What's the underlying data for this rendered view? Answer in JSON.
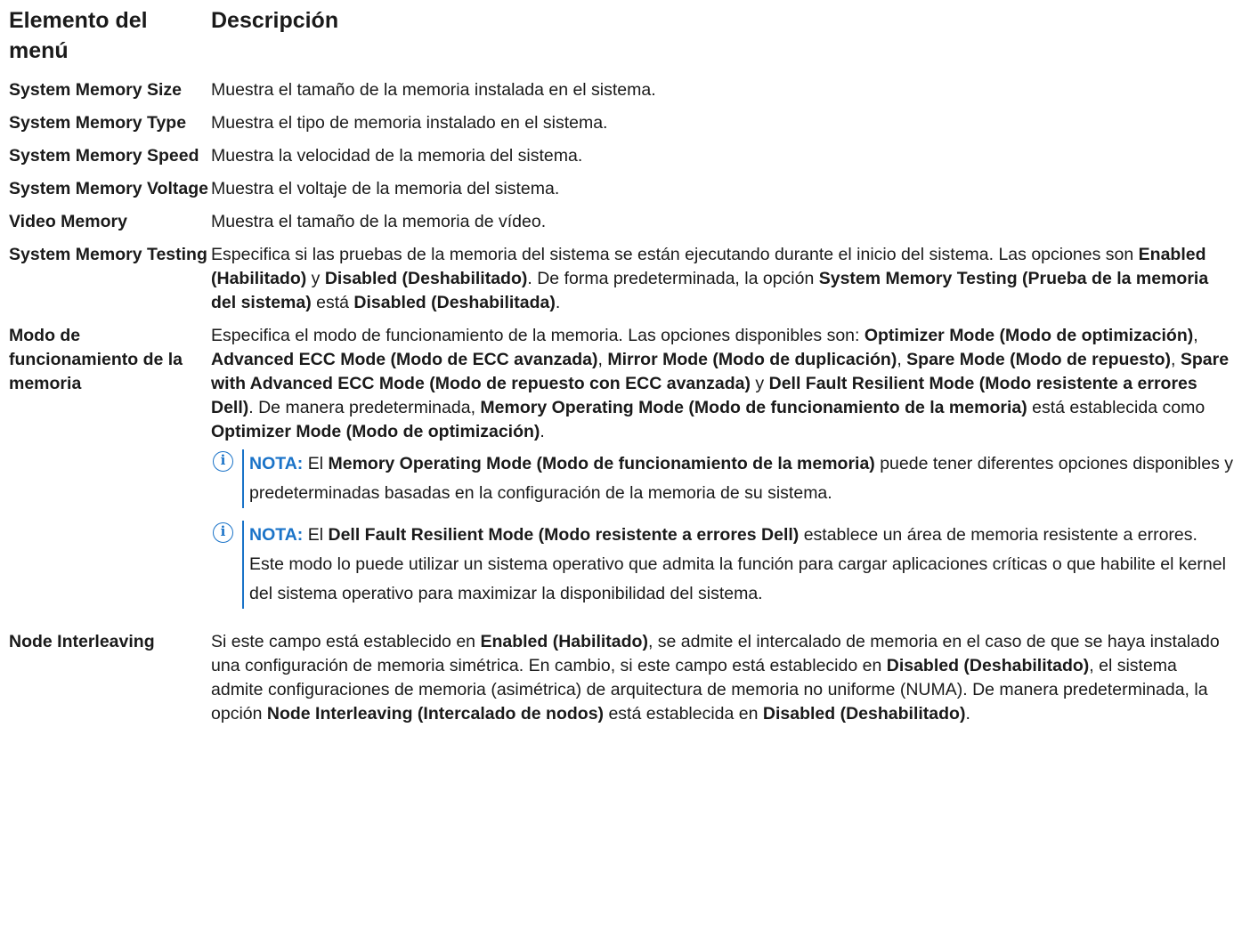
{
  "header": {
    "col1": "Elemento del menú",
    "col2": "Descripción"
  },
  "rows": [
    {
      "name": "System Memory Size",
      "desc": "Muestra el tamaño de la memoria instalada en el sistema."
    },
    {
      "name": "System Memory Type",
      "desc": "Muestra el tipo de memoria instalado en el sistema."
    },
    {
      "name": "System Memory Speed",
      "desc": "Muestra la velocidad de la memoria del sistema."
    },
    {
      "name": "System Memory Voltage",
      "desc": "Muestra el voltaje de la memoria del sistema."
    },
    {
      "name": "Video Memory",
      "desc": "Muestra el tamaño de la memoria de vídeo."
    }
  ],
  "testing": {
    "name": "System Memory Testing",
    "t1": "Especifica si las pruebas de la memoria del sistema se están ejecutando durante el inicio del sistema. Las opciones son ",
    "b1": "Enabled (Habilitado)",
    "t2": " y ",
    "b2": "Disabled (Deshabilitado)",
    "t3": ". De forma predeterminada, la opción ",
    "b3": "System Memory Testing (Prueba de la memoria del sistema)",
    "t4": " está ",
    "b4": "Disabled (Deshabilitada)",
    "t5": "."
  },
  "opmode": {
    "name": "Modo de funcionamiento de la memoria",
    "t1": "Especifica el modo de funcionamiento de la memoria. Las opciones disponibles son: ",
    "b1": "Optimizer Mode (Modo de optimización)",
    "t2": ", ",
    "b2": "Advanced ECC Mode (Modo de ECC avanzada)",
    "t3": ", ",
    "b3": "Mirror Mode (Modo de duplicación)",
    "t4": ", ",
    "b4": "Spare Mode (Modo de repuesto)",
    "t5": ", ",
    "b5": "Spare with Advanced ECC Mode (Modo de repuesto con ECC avanzada)",
    "t6": " y ",
    "b6": "Dell Fault Resilient Mode (Modo resistente a errores Dell)",
    "t7": ". De manera predeterminada, ",
    "b7": "Memory Operating Mode (Modo de funcionamiento de la memoria)",
    "t8": " está establecida como ",
    "b8": "Optimizer Mode (Modo de optimización)",
    "t9": ".",
    "note1": {
      "label": "NOTA:",
      "t1": " El ",
      "b1": "Memory Operating Mode (Modo de funcionamiento de la memoria)",
      "t2": " puede tener diferentes opciones disponibles y predeterminadas basadas en la configuración de la memoria de su sistema."
    },
    "note2": {
      "label": "NOTA:",
      "t1": " El ",
      "b1": "Dell Fault Resilient Mode (Modo resistente a errores Dell)",
      "t2": " establece un área de memoria resistente a errores. Este modo lo puede utilizar un sistema operativo que admita la función para cargar aplicaciones críticas o que habilite el kernel del sistema operativo para maximizar la disponibilidad del sistema."
    }
  },
  "interleave": {
    "name": "Node Interleaving",
    "t1": "Si este campo está establecido en ",
    "b1": "Enabled (Habilitado)",
    "t2": ", se admite el intercalado de memoria en el caso de que se haya instalado una configuración de memoria simétrica. En cambio, si este campo está establecido en ",
    "b2": "Disabled (Deshabilitado)",
    "t3": ", el sistema admite configuraciones de memoria (asimétrica) de arquitectura de memoria no uniforme (NUMA). De manera predeterminada, la opción ",
    "b3": "Node Interleaving (Intercalado de nodos)",
    "t4": " está establecida en ",
    "b4": "Disabled (Deshabilitado)",
    "t5": "."
  },
  "icons": {
    "note": "info-icon",
    "note_glyph": "i"
  },
  "colors": {
    "accent": "#1a73c8",
    "text": "#1a1a1a"
  }
}
